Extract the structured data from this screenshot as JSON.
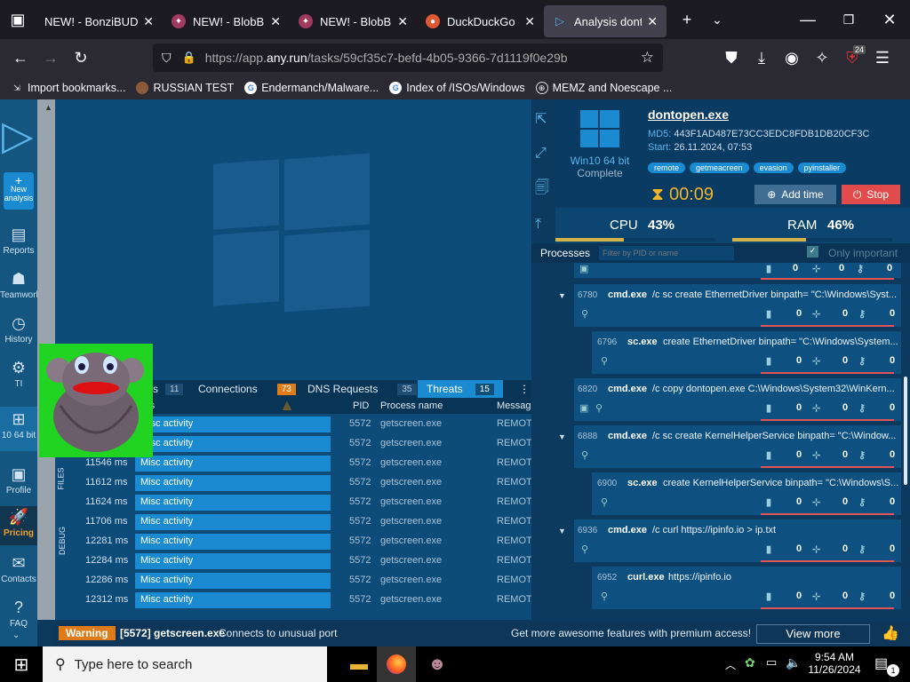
{
  "browser": {
    "tabs": [
      {
        "title": "NEW! - BonziBUDDY!",
        "icon": "bonzi-favicon",
        "active": false
      },
      {
        "title": "NEW! - BlobBUD",
        "icon": "blob-favicon",
        "active": false
      },
      {
        "title": "NEW! - BlobBUD",
        "icon": "blob-favicon",
        "active": false
      },
      {
        "title": "DuckDuckGo - Y",
        "icon": "duckduckgo-favicon",
        "active": false
      },
      {
        "title": "Analysis dontop",
        "icon": "anyrun-favicon",
        "active": true
      }
    ],
    "url_prefix": "https://app.",
    "url_host": "any.run",
    "url_path": "/tasks/59cf35c7-befd-4b05-9366-7d1119f0e29b",
    "extension_badge": "24",
    "bookmarks": [
      "Import bookmarks...",
      "RUSSIAN TEST",
      "Endermanch/Malware...",
      "Index of /ISOs/Windows",
      "MEMZ and Noescape ..."
    ]
  },
  "sidebar": {
    "items": [
      {
        "label": "New analysis",
        "icon": "plus-icon"
      },
      {
        "label": "Reports",
        "icon": "document-icon"
      },
      {
        "label": "Teamwork",
        "icon": "team-icon"
      },
      {
        "label": "History",
        "icon": "history-icon"
      },
      {
        "label": "TI",
        "icon": "gear-icon"
      },
      {
        "label": "10 64 bit",
        "icon": "windows-icon"
      },
      {
        "label": "Profile",
        "icon": "profile-icon"
      },
      {
        "label": "Pricing",
        "icon": "rocket-icon"
      },
      {
        "label": "Contacts",
        "icon": "mail-icon"
      },
      {
        "label": "FAQ",
        "icon": "help-icon"
      }
    ]
  },
  "lower_panel": {
    "tabs": [
      {
        "label": "s",
        "count": "11"
      },
      {
        "label": "Connections",
        "count": "73"
      },
      {
        "label": "DNS Requests",
        "count": "35"
      },
      {
        "label": "Threats",
        "count": "15"
      }
    ],
    "columns": [
      "ass",
      "PID",
      "Process name",
      "Messag"
    ],
    "side_labels": [
      "FILES",
      "DEBUG"
    ],
    "rows": [
      {
        "time": "",
        "cls": "Misc activity",
        "pid": "5572",
        "process": "getscreen.exe",
        "msg": "REMOT"
      },
      {
        "time": "",
        "cls": "Misc activity",
        "pid": "5572",
        "process": "getscreen.exe",
        "msg": "REMOT"
      },
      {
        "time": "11546 ms",
        "cls": "Misc activity",
        "pid": "5572",
        "process": "getscreen.exe",
        "msg": "REMOT"
      },
      {
        "time": "11612 ms",
        "cls": "Misc activity",
        "pid": "5572",
        "process": "getscreen.exe",
        "msg": "REMOT"
      },
      {
        "time": "11624 ms",
        "cls": "Misc activity",
        "pid": "5572",
        "process": "getscreen.exe",
        "msg": "REMOT"
      },
      {
        "time": "11706 ms",
        "cls": "Misc activity",
        "pid": "5572",
        "process": "getscreen.exe",
        "msg": "REMOT"
      },
      {
        "time": "12281 ms",
        "cls": "Misc activity",
        "pid": "5572",
        "process": "getscreen.exe",
        "msg": "REMOT"
      },
      {
        "time": "12284 ms",
        "cls": "Misc activity",
        "pid": "5572",
        "process": "getscreen.exe",
        "msg": "REMOT"
      },
      {
        "time": "12286 ms",
        "cls": "Misc activity",
        "pid": "5572",
        "process": "getscreen.exe",
        "msg": "REMOT"
      },
      {
        "time": "12312 ms",
        "cls": "Misc activity",
        "pid": "5572",
        "process": "getscreen.exe",
        "msg": "REMOT"
      }
    ]
  },
  "status_bar": {
    "level": "Warning",
    "process": "[5572] getscreen.exe",
    "message": "Connects to unusual port",
    "promo": "Get more awesome features with premium access!",
    "view_more": "View more"
  },
  "analysis": {
    "os": "Win10 64 bit",
    "state": "Complete",
    "filename": "dontopen.exe",
    "md5_label": "MD5:",
    "md5": "443F1AD487E73CC3EDC8FDB1DB20CF3C",
    "start_label": "Start:",
    "start": "26.11.2024, 07:53",
    "tags": [
      "remote",
      "getmeacreen",
      "evasion",
      "pyinstaller"
    ],
    "timer": "00:09",
    "add_time": "Add time",
    "stop": "Stop",
    "cpu_label": "CPU",
    "cpu": "43%",
    "ram_label": "RAM",
    "ram": "46%",
    "cpu_fraction": 0.43,
    "ram_fraction": 0.46
  },
  "processes": {
    "title": "Processes",
    "filter_placeholder": "Filter by PID or name",
    "only_important": "Only important",
    "items": [
      {
        "pid": "6780",
        "name": "cmd.exe",
        "cmd": "/c sc create EthernetDriver binpath= \"C:\\Windows\\Syst..."
      },
      {
        "pid": "6796",
        "name": "sc.exe",
        "cmd": "create EthernetDriver binpath= \"C:\\Windows\\System..."
      },
      {
        "pid": "6820",
        "name": "cmd.exe",
        "cmd": "/c copy dontopen.exe C:\\Windows\\System32\\WinKern..."
      },
      {
        "pid": "6888",
        "name": "cmd.exe",
        "cmd": "/c sc create KernelHelperService binpath= \"C:\\Window..."
      },
      {
        "pid": "6900",
        "name": "sc.exe",
        "cmd": "create KernelHelperService binpath= \"C:\\Windows\\S..."
      },
      {
        "pid": "6936",
        "name": "cmd.exe",
        "cmd": "/c curl https://ipinfo.io > ip.txt"
      },
      {
        "pid": "6952",
        "name": "curl.exe",
        "cmd": "https://ipinfo.io"
      }
    ],
    "stat_value": "0"
  },
  "taskbar": {
    "search_placeholder": "Type here to search",
    "time": "9:54 AM",
    "date": "11/26/2024",
    "notif_count": "1"
  }
}
